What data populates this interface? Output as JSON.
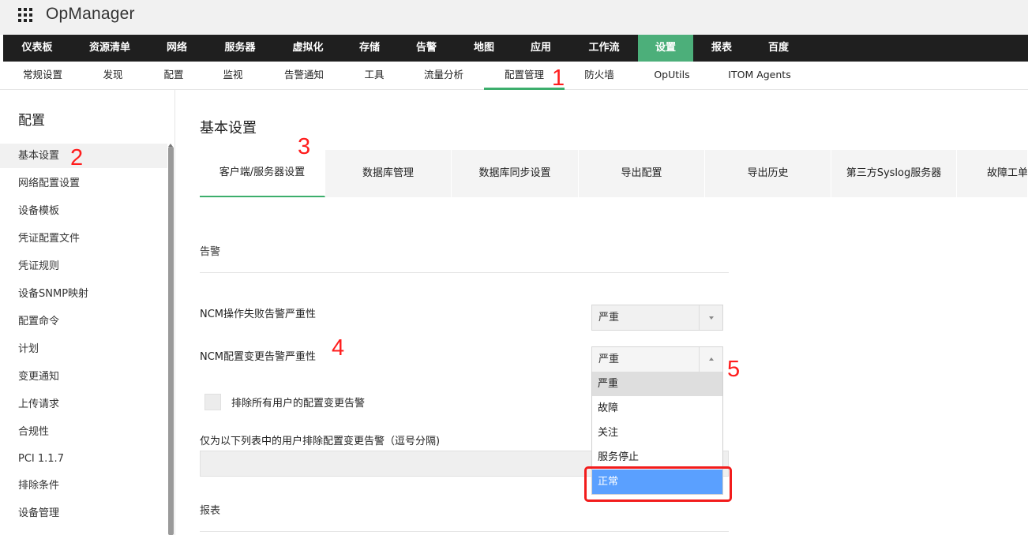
{
  "app": {
    "title": "OpManager",
    "icon": "apps-grid-icon"
  },
  "main_nav": {
    "items": [
      "仪表板",
      "资源清单",
      "网络",
      "服务器",
      "虚拟化",
      "存储",
      "告警",
      "地图",
      "应用",
      "工作流",
      "设置",
      "报表",
      "百度"
    ],
    "active": "设置"
  },
  "sub_nav": {
    "items": [
      "常规设置",
      "发现",
      "配置",
      "监视",
      "告警通知",
      "工具",
      "流量分析",
      "配置管理",
      "防火墙",
      "OpUtils",
      "ITOM Agents"
    ],
    "active": "配置管理"
  },
  "sidebar": {
    "heading": "配置",
    "items": [
      "基本设置",
      "网络配置设置",
      "设备模板",
      "凭证配置文件",
      "凭证规则",
      "设备SNMP映射",
      "配置命令",
      "计划",
      "变更通知",
      "上传请求",
      "合规性",
      "PCI 1.1.7",
      "排除条件",
      "设备管理"
    ],
    "active": "基本设置"
  },
  "content": {
    "title": "基本设置",
    "tabs": [
      "客户端/服务器设置",
      "数据库管理",
      "数据库同步设置",
      "导出配置",
      "导出历史",
      "第三方Syslog服务器",
      "故障工单"
    ],
    "active_tab": "客户端/服务器设置",
    "alarm_section": "告警",
    "ncm_fail_label": "NCM操作失败告警严重性",
    "ncm_fail_value": "严重",
    "ncm_change_label": "NCM配置变更告警严重性",
    "ncm_change_value": "严重",
    "severity_options": [
      "严重",
      "故障",
      "关注",
      "服务停止",
      "正常"
    ],
    "highlighted_option": "严重",
    "selected_option": "正常",
    "exclude_all_label": "排除所有用户的配置变更告警",
    "exclude_list_label": "仅为以下列表中的用户排除配置变更告警（逗号分隔)",
    "exclude_list_value": "",
    "report_section": "报表"
  },
  "annotations": [
    "1",
    "2",
    "3",
    "4",
    "5"
  ],
  "colors": {
    "accent_green": "#3cae6c",
    "nav_active_bg": "#4caf7a",
    "nav_bg": "#1f1f1f",
    "annotation_red": "#ff1d1d",
    "selected_blue": "#5aa0ff"
  }
}
